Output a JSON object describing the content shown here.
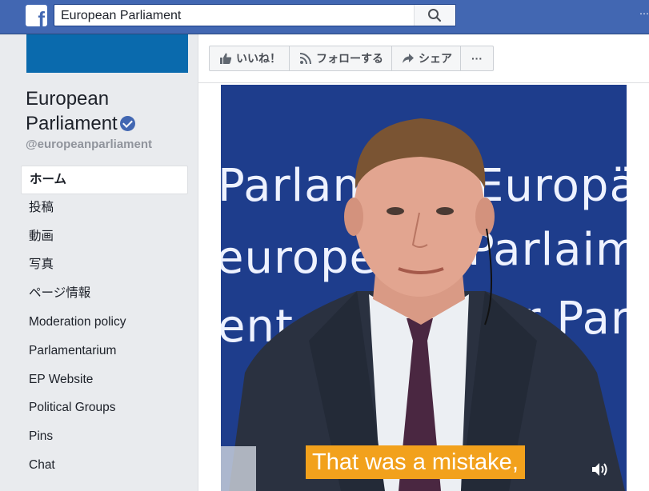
{
  "topbar": {
    "logo_letter": "f",
    "search_value": "European Parliament",
    "brand_color": "#4267b2"
  },
  "sidebar": {
    "page_name": "European Parliament",
    "page_name_line1": "European",
    "page_name_line2": "Parliament",
    "handle": "@europeanparliament",
    "items": [
      {
        "label": "ホーム",
        "active": true
      },
      {
        "label": "投稿"
      },
      {
        "label": "動画"
      },
      {
        "label": "写真"
      },
      {
        "label": "ページ情報"
      },
      {
        "label": "Moderation policy"
      },
      {
        "label": "Parlamentarium"
      },
      {
        "label": "EP Website"
      },
      {
        "label": "Political Groups"
      },
      {
        "label": "Pins"
      },
      {
        "label": "Chat"
      }
    ]
  },
  "actions": {
    "like_label": "いいね！",
    "follow_label": "フォローする",
    "share_label": "シェア",
    "more_label": "···"
  },
  "video": {
    "caption": "That was a mistake,",
    "background_lines": [
      "Parlament",
      "Europäis",
      "européen",
      "Parlaime",
      "ent",
      "ur Parla"
    ],
    "caption_color": "#f2a11c"
  }
}
